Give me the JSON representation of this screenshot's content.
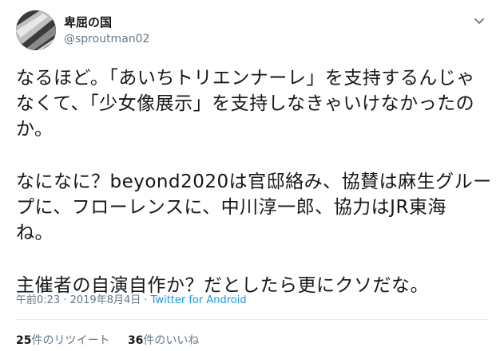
{
  "user": {
    "display_name": "卑屈の国",
    "screen_name": "@sproutman02"
  },
  "tweet": {
    "lines": [
      "なるほど。「あいちトリエンナーレ」を支持するんじゃ",
      "なくて、「少女像展示」を支持しなきゃいけなかったの",
      "か。",
      "なになに？beyond2020は官邸絡み、協賛は麻生グルー",
      "プに、フローレンスに、中川淳一郎、協力はJR東海",
      "ね。",
      "主催者の自演自作か？だとしたら更にクソだな。"
    ]
  },
  "meta": {
    "time": "午前0:23",
    "separator": " · ",
    "date": "2019年8月4日",
    "source": "Twitter for Android"
  },
  "stats": {
    "retweet_count": "25",
    "retweet_label": "件のリツイート",
    "like_count": "36",
    "like_label": "件のいいね"
  },
  "colors": {
    "link": "#1b95e0",
    "secondary": "#657786",
    "primary": "#14171a",
    "divider": "#e6ecf0"
  },
  "icons": {
    "caret": "chevron-down-icon",
    "avatar": "avatar"
  }
}
